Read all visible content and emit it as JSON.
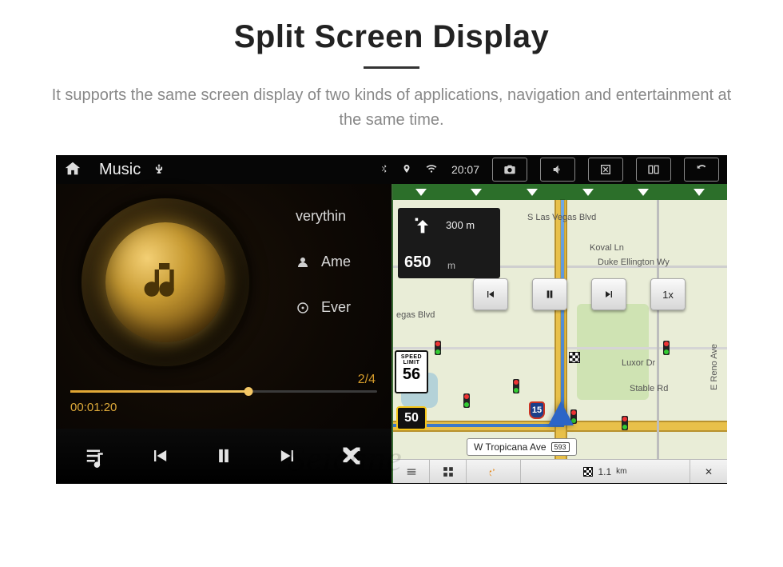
{
  "heading": {
    "title": "Split Screen Display",
    "subtitle": "It supports the same screen display of two kinds of applications, navigation and entertainment at the same time."
  },
  "statusbar": {
    "app_title": "Music",
    "time": "20:07",
    "icons": {
      "home": "home-icon",
      "usb": "usb-icon",
      "bt": "bluetooth-icon",
      "gps": "location-icon",
      "wifi": "wifi-icon",
      "camera": "camera-icon",
      "volume": "volume-icon",
      "close": "close-window-icon",
      "splitscreen": "splitscreen-icon",
      "back": "back-icon"
    }
  },
  "music": {
    "track_title": "verythin",
    "artist": "Ame",
    "album": "Ever",
    "track_index": "2/4",
    "elapsed": "00:01:20",
    "progress_percent": 58,
    "controls": {
      "playlist": "playlist-icon",
      "prev": "previous-track-icon",
      "pause": "pause-icon",
      "next": "next-track-icon",
      "shuffle": "shuffle-icon"
    }
  },
  "map": {
    "download_arrows": 6,
    "streets": {
      "s_las_vegas": "S Las Vegas Blvd",
      "koval": "Koval Ln",
      "duke": "Duke Ellington Wy",
      "stable": "Stable Rd",
      "reno": "E Reno Ave",
      "tropicana": "W Tropicana Ave",
      "luxor": "Luxor Dr",
      "vegas_blvd_partial": "egas Blvd"
    },
    "current_road": "W Tropicana Ave",
    "current_road_exit": "593",
    "turn": {
      "next_distance": "300 m",
      "maneuver_distance": "650",
      "maneuver_units": "m"
    },
    "speed_limit_label": "SPEED LIMIT",
    "speed_limit": "56",
    "speed_current": "50",
    "interstate": "15",
    "sim": {
      "prev": "step-back-icon",
      "pause": "pause-icon",
      "next": "step-forward-icon",
      "rate": "1x"
    },
    "bottombar": {
      "dest_distance": "1.1",
      "dest_units": "km",
      "close": "✕"
    }
  },
  "watermark": "Seicane"
}
